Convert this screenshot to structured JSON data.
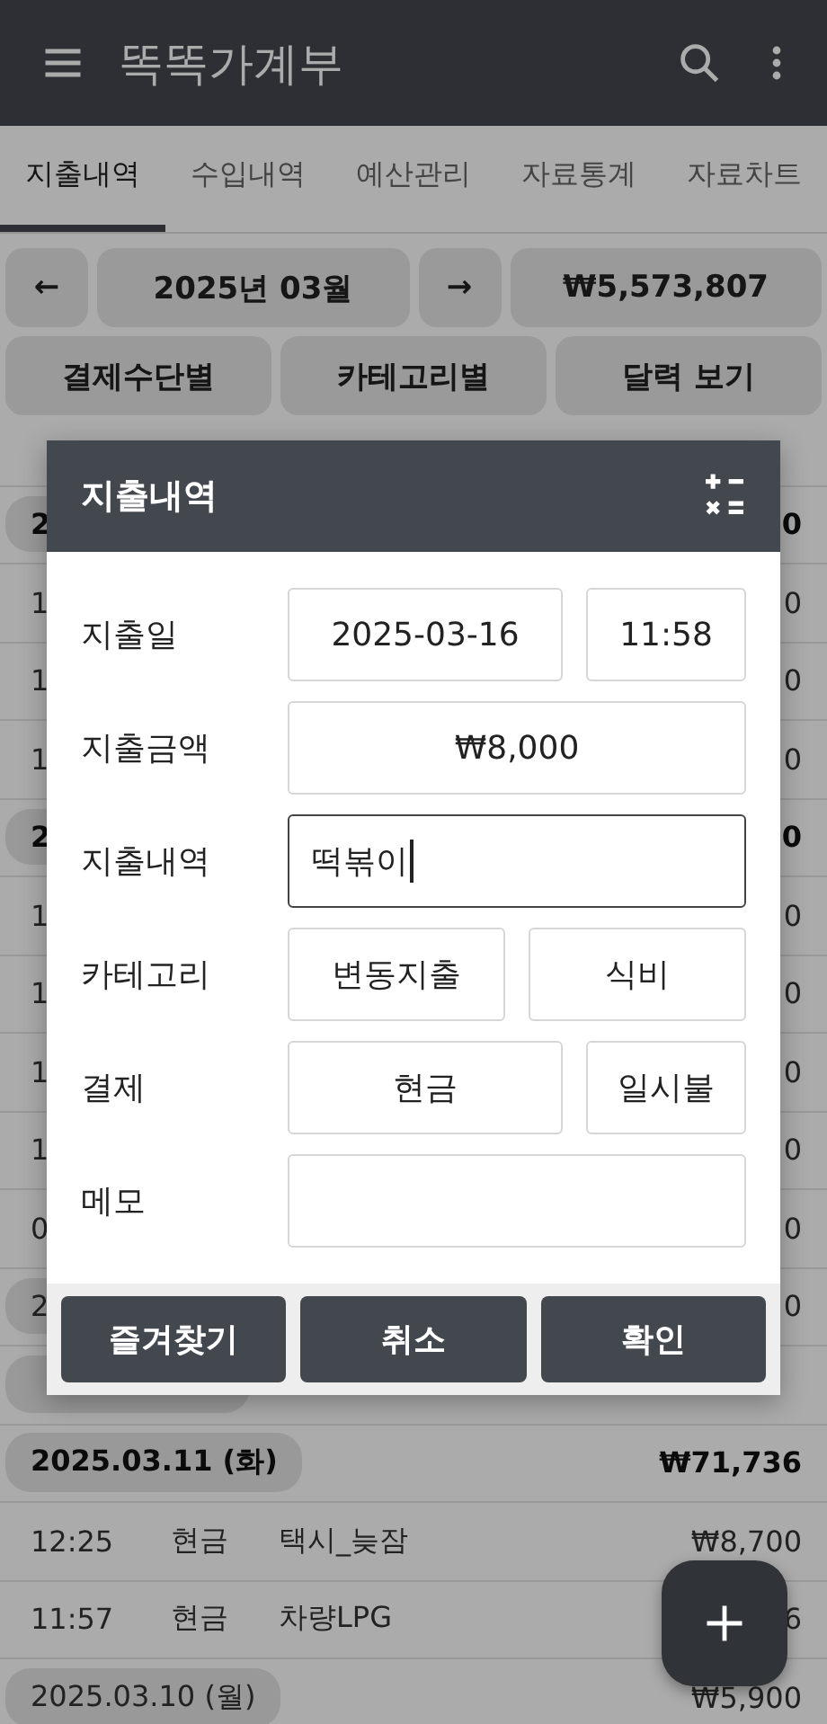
{
  "app_bar": {
    "title": "똑똑가계부"
  },
  "tabs": [
    {
      "label": "지출내역",
      "selected": true
    },
    {
      "label": "수입내역",
      "selected": false
    },
    {
      "label": "예산관리",
      "selected": false
    },
    {
      "label": "자료통계",
      "selected": false
    },
    {
      "label": "자료차트",
      "selected": false
    }
  ],
  "month_nav": {
    "prev": "←",
    "month": "2025년 03월",
    "next": "→",
    "total": "₩5,573,807"
  },
  "views": [
    "결제수단별",
    "카테고리별",
    "달력 보기"
  ],
  "list": [
    {
      "kind": "row"
    },
    {
      "kind": "header",
      "date": "2",
      "amount": "0",
      "bold": true
    },
    {
      "kind": "row",
      "time": "1",
      "amount": "0"
    },
    {
      "kind": "row",
      "time": "1",
      "amount": "0"
    },
    {
      "kind": "row",
      "time": "1",
      "amount": "0"
    },
    {
      "kind": "header",
      "date": "2",
      "amount": "0",
      "bold": true
    },
    {
      "kind": "row",
      "time": "1",
      "amount": "0"
    },
    {
      "kind": "row",
      "time": "1",
      "amount": "0"
    },
    {
      "kind": "row",
      "time": "1",
      "amount": "0"
    },
    {
      "kind": "row",
      "time": "1",
      "amount": "0"
    },
    {
      "kind": "row",
      "time": "0",
      "amount": "0"
    },
    {
      "kind": "header",
      "date": "2",
      "amount": "0",
      "bold": false
    },
    {
      "kind": "header"
    },
    {
      "kind": "header",
      "date": "2025.03.11 (화)",
      "amount": "₩71,736",
      "bold": true
    },
    {
      "kind": "row",
      "time": "12:25",
      "method": "현금",
      "desc": "택시_늦잠",
      "amount": "₩8,700"
    },
    {
      "kind": "row",
      "time": "11:57",
      "method": "현금",
      "desc": "차량LPG",
      "amount": "6"
    },
    {
      "kind": "header",
      "date": "2025.03.10 (월)",
      "amount": "₩5,900",
      "bold": false
    }
  ],
  "dialog": {
    "title": "지출내역",
    "fields": [
      {
        "label": "지출일",
        "kind": "split",
        "values": [
          "2025-03-16",
          "11:58"
        ]
      },
      {
        "label": "지출금액",
        "kind": "single",
        "values": [
          "₩8,000"
        ]
      },
      {
        "label": "지출내역",
        "kind": "input",
        "value": "떡볶이",
        "focused": true
      },
      {
        "label": "카테고리",
        "kind": "halves",
        "values": [
          "변동지출",
          "식비"
        ]
      },
      {
        "label": "결제",
        "kind": "split",
        "values": [
          "현금",
          "일시불"
        ]
      },
      {
        "label": "메모",
        "kind": "input",
        "focused": false
      }
    ],
    "buttons": [
      "즐겨찾기",
      "취소",
      "확인"
    ]
  }
}
